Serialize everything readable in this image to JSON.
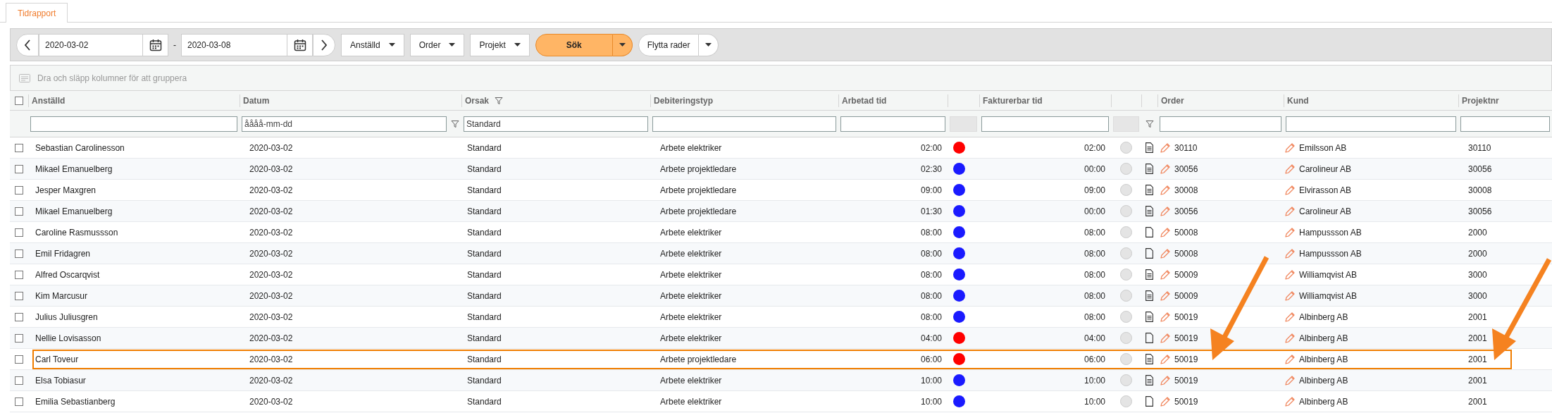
{
  "tab": {
    "label": "Tidrapport",
    "selected": true
  },
  "toolbar": {
    "date_from": "2020-03-02",
    "separator": "-",
    "date_to": "2020-03-08",
    "dropdowns": [
      "Anställd",
      "Order",
      "Projekt"
    ],
    "search_button": "Sök",
    "move_button": "Flytta rader"
  },
  "group_bar": "Dra och släpp kolumner för att gruppera",
  "header": [
    {
      "kind": "checkbox",
      "checked": false
    },
    {
      "kind": "label",
      "label": "Anställd",
      "filtered": false
    },
    {
      "kind": "label",
      "label": "Datum",
      "filtered": false
    },
    {
      "kind": "label",
      "label": "Orsak",
      "filtered": true
    },
    {
      "kind": "label",
      "label": "Debiteringstyp",
      "filtered": false
    },
    {
      "kind": "label",
      "label": "Arbetad tid",
      "filtered": false
    },
    {
      "kind": "blank"
    },
    {
      "kind": "label",
      "label": "Fakturerbar tid",
      "filtered": false
    },
    {
      "kind": "blank"
    },
    {
      "kind": "blank"
    },
    {
      "kind": "label",
      "label": "Order",
      "filtered": false
    },
    {
      "kind": "label",
      "label": "Kund",
      "filtered": false
    },
    {
      "kind": "label",
      "label": "Projektnr",
      "filtered": false
    }
  ],
  "filters": [
    {
      "kind": "none"
    },
    {
      "kind": "input"
    },
    {
      "kind": "input",
      "placeholder": "åååå-mm-dd",
      "funnel": true
    },
    {
      "kind": "input",
      "value": "Standard"
    },
    {
      "kind": "input"
    },
    {
      "kind": "input"
    },
    {
      "kind": "grey"
    },
    {
      "kind": "input"
    },
    {
      "kind": "grey"
    },
    {
      "kind": "funnel"
    },
    {
      "kind": "input"
    },
    {
      "kind": "input"
    },
    {
      "kind": "input"
    }
  ],
  "rows": [
    {
      "checked": false,
      "highlighted": false,
      "employee": "Sebastian Carolinesson",
      "date": "2020-03-02",
      "reason": "Standard",
      "billing_type": "Arbete elektriker",
      "worked": "02:00",
      "color": "#ff0000",
      "billable": "02:00",
      "note": true,
      "order": "30110",
      "customer": "Emilsson AB",
      "project": "30110"
    },
    {
      "checked": false,
      "highlighted": false,
      "employee": "Mikael Emanuelberg",
      "date": "2020-03-02",
      "reason": "Standard",
      "billing_type": "Arbete projektledare",
      "worked": "02:30",
      "color": "#1a1aff",
      "billable": "00:00",
      "note": true,
      "order": "30056",
      "customer": "Carolineur AB",
      "project": "30056"
    },
    {
      "checked": false,
      "highlighted": false,
      "employee": "Jesper Maxgren",
      "date": "2020-03-02",
      "reason": "Standard",
      "billing_type": "Arbete projektledare",
      "worked": "09:00",
      "color": "#1a1aff",
      "billable": "09:00",
      "note": true,
      "order": "30008",
      "customer": "Elvirasson AB",
      "project": "30008"
    },
    {
      "checked": false,
      "highlighted": false,
      "employee": "Mikael Emanuelberg",
      "date": "2020-03-02",
      "reason": "Standard",
      "billing_type": "Arbete projektledare",
      "worked": "01:30",
      "color": "#1a1aff",
      "billable": "00:00",
      "note": true,
      "order": "30056",
      "customer": "Carolineur AB",
      "project": "30056"
    },
    {
      "checked": false,
      "highlighted": false,
      "employee": "Caroline Rasmussson",
      "date": "2020-03-02",
      "reason": "Standard",
      "billing_type": "Arbete elektriker",
      "worked": "08:00",
      "color": "#1a1aff",
      "billable": "08:00",
      "note": false,
      "order": "50008",
      "customer": "Hampussson AB",
      "project": "2000"
    },
    {
      "checked": false,
      "highlighted": false,
      "employee": "Emil Fridagren",
      "date": "2020-03-02",
      "reason": "Standard",
      "billing_type": "Arbete elektriker",
      "worked": "08:00",
      "color": "#1a1aff",
      "billable": "08:00",
      "note": false,
      "order": "50008",
      "customer": "Hampussson AB",
      "project": "2000"
    },
    {
      "checked": false,
      "highlighted": false,
      "employee": "Alfred Oscarqvist",
      "date": "2020-03-02",
      "reason": "Standard",
      "billing_type": "Arbete elektriker",
      "worked": "08:00",
      "color": "#1a1aff",
      "billable": "08:00",
      "note": true,
      "order": "50009",
      "customer": "Williamqvist AB",
      "project": "3000"
    },
    {
      "checked": false,
      "highlighted": false,
      "employee": "Kim Marcusur",
      "date": "2020-03-02",
      "reason": "Standard",
      "billing_type": "Arbete elektriker",
      "worked": "08:00",
      "color": "#1a1aff",
      "billable": "08:00",
      "note": true,
      "order": "50009",
      "customer": "Williamqvist AB",
      "project": "3000"
    },
    {
      "checked": false,
      "highlighted": false,
      "employee": "Julius Juliusgren",
      "date": "2020-03-02",
      "reason": "Standard",
      "billing_type": "Arbete elektriker",
      "worked": "08:00",
      "color": "#1a1aff",
      "billable": "08:00",
      "note": true,
      "order": "50019",
      "customer": "Albinberg AB",
      "project": "2001"
    },
    {
      "checked": false,
      "highlighted": false,
      "employee": "Nellie Lovisasson",
      "date": "2020-03-02",
      "reason": "Standard",
      "billing_type": "Arbete elektriker",
      "worked": "04:00",
      "color": "#ff0000",
      "billable": "04:00",
      "note": false,
      "order": "50019",
      "customer": "Albinberg AB",
      "project": "2001"
    },
    {
      "checked": false,
      "highlighted": true,
      "employee": "Carl Toveur",
      "date": "2020-03-02",
      "reason": "Standard",
      "billing_type": "Arbete projektledare",
      "worked": "06:00",
      "color": "#ff0000",
      "billable": "06:00",
      "note": true,
      "order": "50019",
      "customer": "Albinberg AB",
      "project": "2001"
    },
    {
      "checked": false,
      "highlighted": false,
      "employee": "Elsa Tobiasur",
      "date": "2020-03-02",
      "reason": "Standard",
      "billing_type": "Arbete elektriker",
      "worked": "10:00",
      "color": "#1a1aff",
      "billable": "10:00",
      "note": true,
      "order": "50019",
      "customer": "Albinberg AB",
      "project": "2001"
    },
    {
      "checked": false,
      "highlighted": false,
      "employee": "Emilia Sebastianberg",
      "date": "2020-03-02",
      "reason": "Standard",
      "billing_type": "Arbete elektriker",
      "worked": "10:00",
      "color": "#1a1aff",
      "billable": "10:00",
      "note": false,
      "order": "50019",
      "customer": "Albinberg AB",
      "project": "2001"
    }
  ]
}
